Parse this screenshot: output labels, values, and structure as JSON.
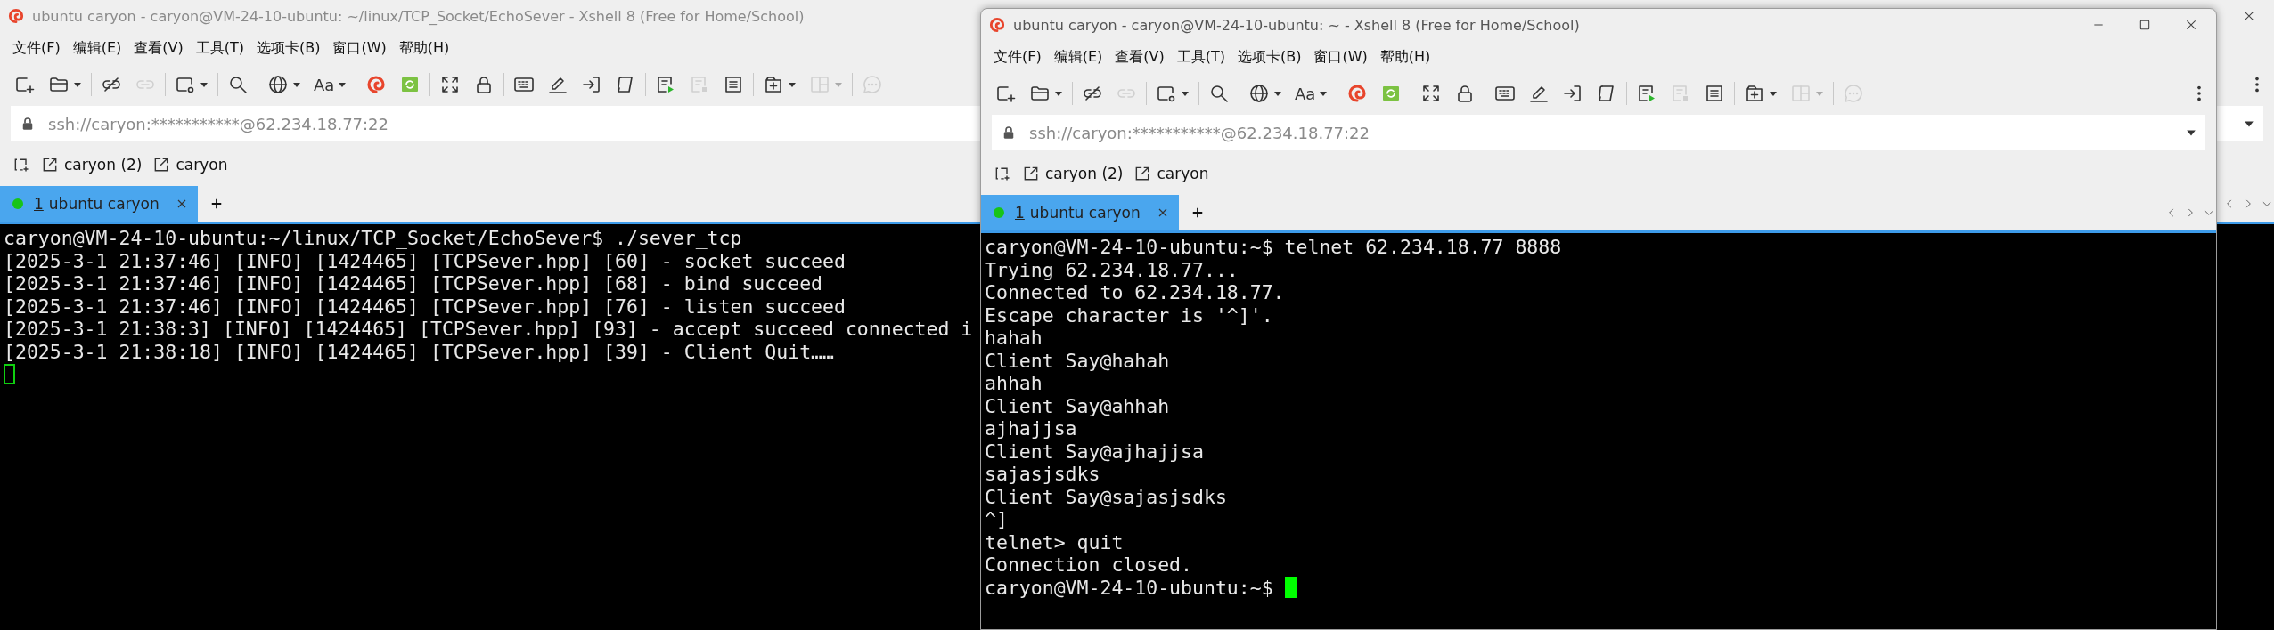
{
  "windows": [
    {
      "title": "ubuntu caryon - caryon@VM-24-10-ubuntu: ~/linux/TCP_Socket/EchoSever - Xshell 8 (Free for Home/School)",
      "active": false,
      "buttons": [
        {
          "kind": "close"
        }
      ],
      "menu": [
        "文件(F)",
        "编辑(E)",
        "查看(V)",
        "工具(T)",
        "选项卡(B)",
        "窗口(W)",
        "帮助(H)"
      ],
      "toolbar": [
        [
          {
            "disabled": false,
            "dropdown": false
          },
          {
            "disabled": false,
            "dropdown": true
          }
        ],
        [
          {
            "disabled": false,
            "dropdown": false
          },
          {
            "disabled": true,
            "dropdown": false
          }
        ],
        [
          {
            "disabled": false,
            "dropdown": true
          }
        ],
        [
          {
            "disabled": false,
            "dropdown": false
          }
        ],
        [
          {
            "disabled": false,
            "dropdown": true
          },
          {
            "label": "Aa",
            "disabled": false,
            "dropdown": true
          }
        ],
        [
          {
            "disabled": false,
            "dropdown": false
          },
          {
            "disabled": false,
            "dropdown": false
          }
        ],
        [
          {
            "disabled": false,
            "dropdown": false
          },
          {
            "disabled": false,
            "dropdown": false
          }
        ],
        [
          {
            "disabled": false,
            "dropdown": false
          },
          {
            "disabled": false,
            "dropdown": false
          },
          {
            "disabled": false,
            "dropdown": false
          },
          {
            "disabled": false,
            "dropdown": false
          }
        ],
        [
          {
            "disabled": false,
            "dropdown": false
          },
          {
            "disabled": true,
            "dropdown": false
          },
          {
            "disabled": false,
            "dropdown": false
          }
        ],
        [
          {
            "disabled": false,
            "dropdown": true
          },
          {
            "disabled": true,
            "dropdown": true
          }
        ],
        [
          {
            "disabled": true,
            "dropdown": false
          }
        ]
      ],
      "address": "ssh://caryon:***********@62.234.18.77:22",
      "quick_links": [
        "caryon (2)",
        "caryon"
      ],
      "tabs": [
        {
          "number": "1",
          "label": "ubuntu caryon",
          "selected": true,
          "connected": true
        }
      ],
      "terminal": {
        "lines": [
          "caryon@VM-24-10-ubuntu:~/linux/TCP_Socket/EchoSever$ ./sever_tcp",
          "[2025-3-1 21:37:46] [INFO] [1424465] [TCPSever.hpp] [60] - socket succeed",
          "[2025-3-1 21:37:46] [INFO] [1424465] [TCPSever.hpp] [68] - bind succeed",
          "[2025-3-1 21:37:46] [INFO] [1424465] [TCPSever.hpp] [76] - listen succeed",
          "[2025-3-1 21:38:3] [INFO] [1424465] [TCPSever.hpp] [93] - accept succeed connected i",
          "[2025-3-1 21:38:18] [INFO] [1424465] [TCPSever.hpp] [39] - Client Quit……"
        ],
        "focused": false
      }
    },
    {
      "title": "ubuntu caryon - caryon@VM-24-10-ubuntu: ~ - Xshell 8 (Free for Home/School)",
      "active": true,
      "buttons": [
        {
          "kind": "minimize"
        },
        {
          "kind": "maximize"
        },
        {
          "kind": "close"
        }
      ],
      "menu": [
        "文件(F)",
        "编辑(E)",
        "查看(V)",
        "工具(T)",
        "选项卡(B)",
        "窗口(W)",
        "帮助(H)"
      ],
      "toolbar": [
        [
          {
            "disabled": false,
            "dropdown": false
          },
          {
            "disabled": false,
            "dropdown": true
          }
        ],
        [
          {
            "disabled": false,
            "dropdown": false
          },
          {
            "disabled": true,
            "dropdown": false
          }
        ],
        [
          {
            "disabled": false,
            "dropdown": true
          }
        ],
        [
          {
            "disabled": false,
            "dropdown": false
          }
        ],
        [
          {
            "disabled": false,
            "dropdown": true
          },
          {
            "label": "Aa",
            "disabled": false,
            "dropdown": true
          }
        ],
        [
          {
            "disabled": false,
            "dropdown": false
          },
          {
            "disabled": false,
            "dropdown": false
          }
        ],
        [
          {
            "disabled": false,
            "dropdown": false
          },
          {
            "disabled": false,
            "dropdown": false
          }
        ],
        [
          {
            "disabled": false,
            "dropdown": false
          },
          {
            "disabled": false,
            "dropdown": false
          },
          {
            "disabled": false,
            "dropdown": false
          },
          {
            "disabled": false,
            "dropdown": false
          }
        ],
        [
          {
            "disabled": false,
            "dropdown": false
          },
          {
            "disabled": true,
            "dropdown": false
          },
          {
            "disabled": false,
            "dropdown": false
          }
        ],
        [
          {
            "disabled": false,
            "dropdown": true
          },
          {
            "disabled": true,
            "dropdown": true
          }
        ],
        [
          {
            "disabled": true,
            "dropdown": false
          }
        ]
      ],
      "address": "ssh://caryon:***********@62.234.18.77:22",
      "quick_links": [
        "caryon (2)",
        "caryon"
      ],
      "tabs": [
        {
          "number": "1",
          "label": "ubuntu caryon",
          "selected": true,
          "connected": true
        }
      ],
      "terminal": {
        "lines": [
          "caryon@VM-24-10-ubuntu:~$ telnet 62.234.18.77 8888",
          "Trying 62.234.18.77...",
          "Connected to 62.234.18.77.",
          "Escape character is '^]'.",
          "hahah",
          "Client Say@hahah",
          "ahhah",
          "Client Say@ahhah",
          "ajhajjsa",
          "Client Say@ajhajjsa",
          "sajasjsdks",
          "Client Say@sajasjsdks",
          "^]",
          "telnet> quit",
          "Connection closed."
        ],
        "prompt": "caryon@VM-24-10-ubuntu:~$",
        "focused": true
      }
    }
  ]
}
